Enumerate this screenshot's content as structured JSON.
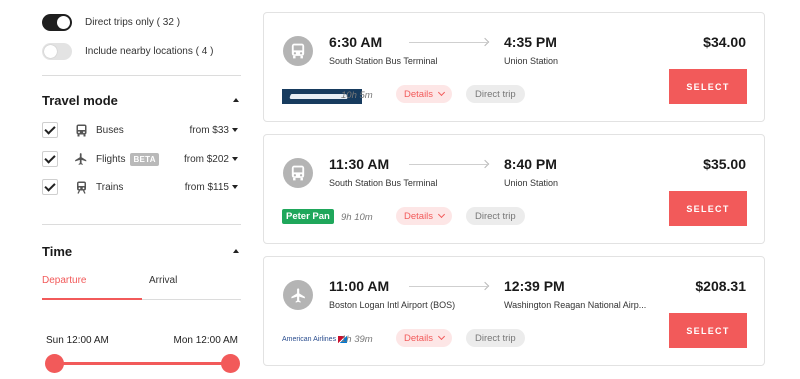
{
  "filters": {
    "direct_trips_label": "Direct trips only ( 32 )",
    "nearby_label": "Include nearby locations ( 4 )"
  },
  "travel_mode": {
    "title": "Travel mode",
    "items": [
      {
        "label": "Buses",
        "badge": "",
        "price": "from $33"
      },
      {
        "label": "Flights",
        "badge": "BETA",
        "price": "from $202"
      },
      {
        "label": "Trains",
        "badge": "",
        "price": "from $115"
      }
    ]
  },
  "time": {
    "title": "Time",
    "tabs": [
      "Departure",
      "Arrival"
    ],
    "range_start": "Sun 12:00 AM",
    "range_end": "Mon 12:00 AM",
    "range_min": 0,
    "range_max": 1
  },
  "trips": [
    {
      "mode_icon": "bus-icon",
      "depart_time": "6:30 AM",
      "depart_station": "South Station Bus Terminal",
      "arrive_time": "4:35 PM",
      "arrive_station": "Union Station",
      "price": "$34.00",
      "carrier": "Greyhound",
      "duration": "10h 5m",
      "details_label": "Details",
      "direct_label": "Direct trip",
      "select_label": "SELECT"
    },
    {
      "mode_icon": "bus-icon",
      "depart_time": "11:30 AM",
      "depart_station": "South Station Bus Terminal",
      "arrive_time": "8:40 PM",
      "arrive_station": "Union Station",
      "price": "$35.00",
      "carrier": "Peter Pan",
      "duration": "9h 10m",
      "details_label": "Details",
      "direct_label": "Direct trip",
      "select_label": "SELECT"
    },
    {
      "mode_icon": "plane-icon",
      "depart_time": "11:00 AM",
      "depart_station": "Boston Logan Intl Airport (BOS)",
      "arrive_time": "12:39 PM",
      "arrive_station": "Washington Reagan National Airp...",
      "price": "$208.31",
      "carrier": "American Airlines",
      "duration": "1h 39m",
      "details_label": "Details",
      "direct_label": "Direct trip",
      "select_label": "SELECT"
    }
  ],
  "colors": {
    "accent": "#f25a5a",
    "accent_light": "#fde6e6",
    "peter_pan_green": "#1fa75b",
    "greyhound_blue": "#173b5e"
  }
}
